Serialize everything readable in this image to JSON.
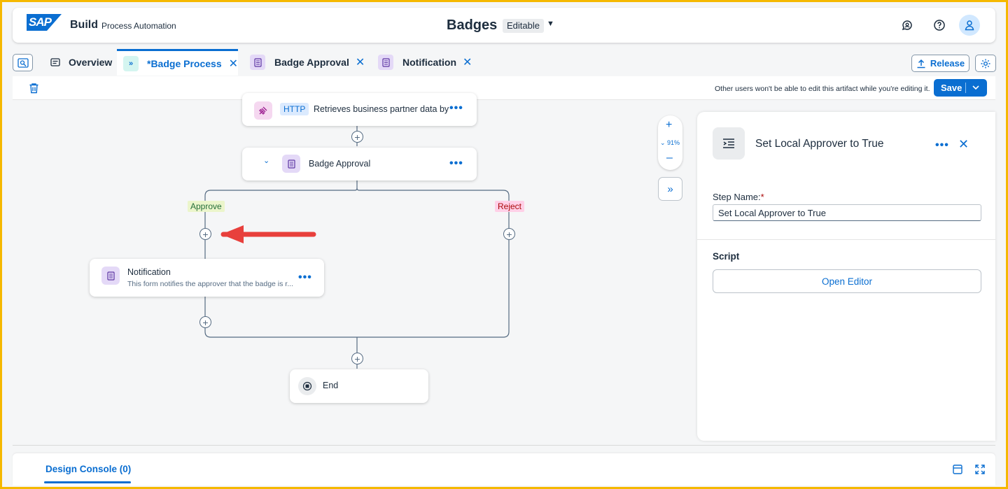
{
  "shell": {
    "logo": "SAP",
    "brand": "Build",
    "product": "Process Automation",
    "title": "Badges",
    "mode": "Editable"
  },
  "tabs": [
    {
      "label": "Overview"
    },
    {
      "label": "*Badge Process",
      "active": true
    },
    {
      "label": "Badge Approval"
    },
    {
      "label": "Notification"
    }
  ],
  "toolbar": {
    "release_label": "Release",
    "edit_message": "Other users won't be able to edit this artifact while you're editing it.",
    "save_label": "Save"
  },
  "flow": {
    "http_tag": "HTTP",
    "http_text": "Retrieves business partner data by",
    "approval_title": "Badge Approval",
    "approve_label": "Approve",
    "reject_label": "Reject",
    "notification_title": "Notification",
    "notification_desc": "This form notifies the approver that the badge is r...",
    "end_label": "End"
  },
  "zoom": {
    "level": "91%"
  },
  "panel": {
    "title": "Set Local Approver to True",
    "step_name_label": "Step Name:",
    "step_name_required": "*",
    "step_name_value": "Set Local Approver to True",
    "script_title": "Script",
    "open_editor_label": "Open Editor"
  },
  "console": {
    "tab_label": "Design Console (0)"
  },
  "colors": {
    "accent": "#0a6ed1",
    "frame": "#f5b800",
    "arrow": "#e8403c",
    "approve_bg": "#ebf5cb",
    "reject_bg": "#ffd0e7"
  }
}
